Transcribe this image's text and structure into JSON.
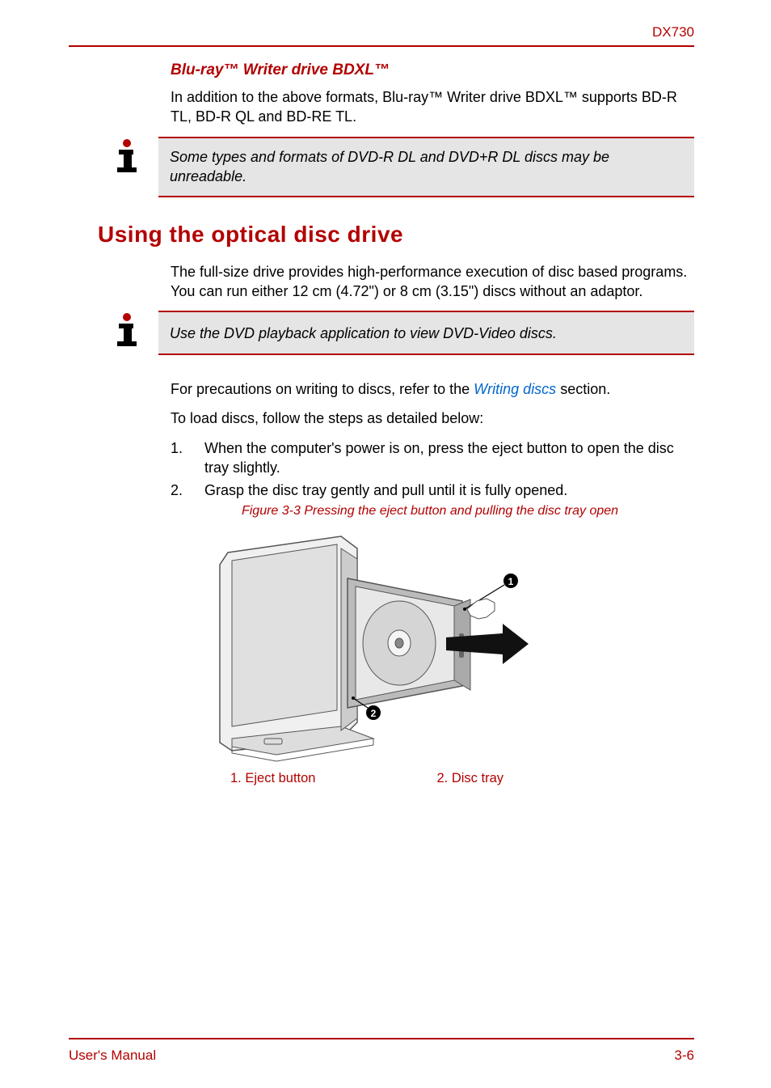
{
  "header": {
    "model": "DX730"
  },
  "bluray": {
    "heading": "Blu-ray™ Writer drive BDXL™",
    "body": "In addition to the above formats, Blu-ray™ Writer drive BDXL™ supports BD-R TL, BD-R QL and BD-RE TL."
  },
  "note1": {
    "text": "Some types and formats of DVD-R DL and DVD+R DL discs may be unreadable."
  },
  "main": {
    "heading": "Using the optical disc drive",
    "body": "The full-size drive provides high-performance execution of disc based programs. You can run either 12 cm (4.72\") or 8 cm (3.15\") discs without an adaptor."
  },
  "note2": {
    "text": "Use the DVD playback application to view DVD-Video discs."
  },
  "precautions": {
    "pre": "For precautions on writing to discs, refer to the ",
    "link": "Writing discs",
    "post": " section."
  },
  "load_intro": "To load discs, follow the steps as detailed below:",
  "steps": [
    {
      "num": "1.",
      "text": "When the computer's power is on, press the eject button to open the disc tray slightly."
    },
    {
      "num": "2.",
      "text": "Grasp the disc tray gently and pull until it is fully opened."
    }
  ],
  "figure": {
    "caption": "Figure 3-3 Pressing the eject button and pulling the disc tray open",
    "legend1": "1. Eject button",
    "legend2": "2. Disc tray"
  },
  "footer": {
    "left": "User's Manual",
    "right": "3-6"
  }
}
